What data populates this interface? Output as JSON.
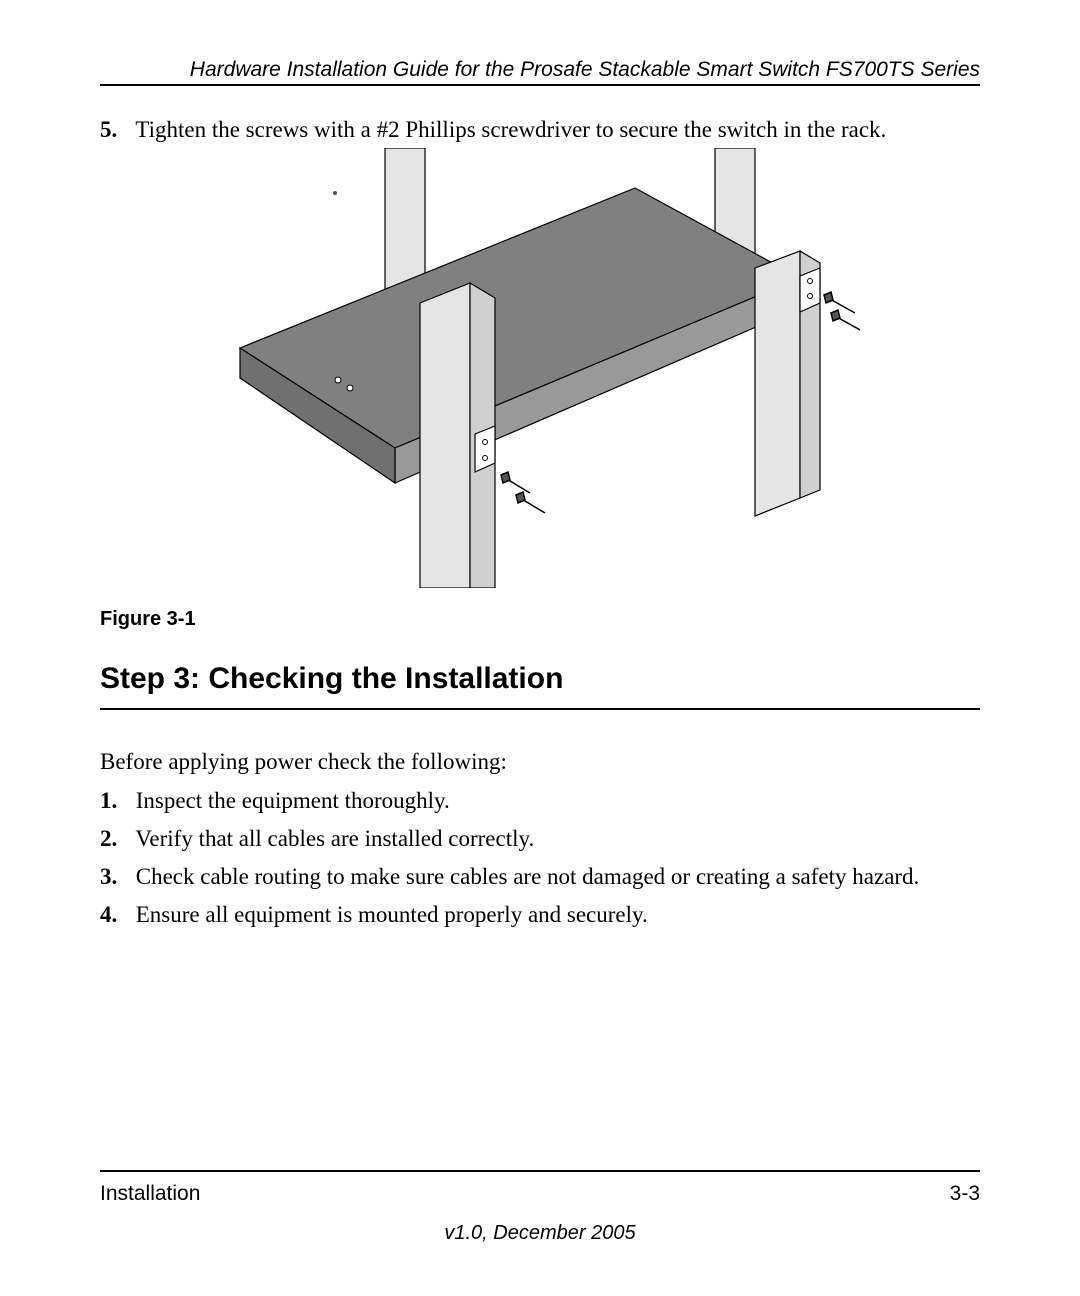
{
  "header": {
    "running_title": "Hardware Installation Guide for the Prosafe Stackable Smart Switch FS700TS Series"
  },
  "step_top": {
    "number": "5.",
    "text": "Tighten the screws with a #2 Phillips screwdriver to secure the switch in the rack."
  },
  "figure": {
    "caption": "Figure 3-1"
  },
  "section": {
    "heading": "Step 3: Checking the Installation",
    "intro": "Before applying power check the following:",
    "items": [
      {
        "n": "1.",
        "text": "Inspect the equipment thoroughly."
      },
      {
        "n": "2.",
        "text": "Verify that all cables are installed correctly."
      },
      {
        "n": "3.",
        "text": "Check cable routing to make sure cables are not damaged or creating a safety hazard."
      },
      {
        "n": "4.",
        "text": "Ensure all equipment is mounted properly and securely."
      }
    ]
  },
  "footer": {
    "left": "Installation",
    "right": "3-3",
    "version": "v1.0, December 2005"
  }
}
